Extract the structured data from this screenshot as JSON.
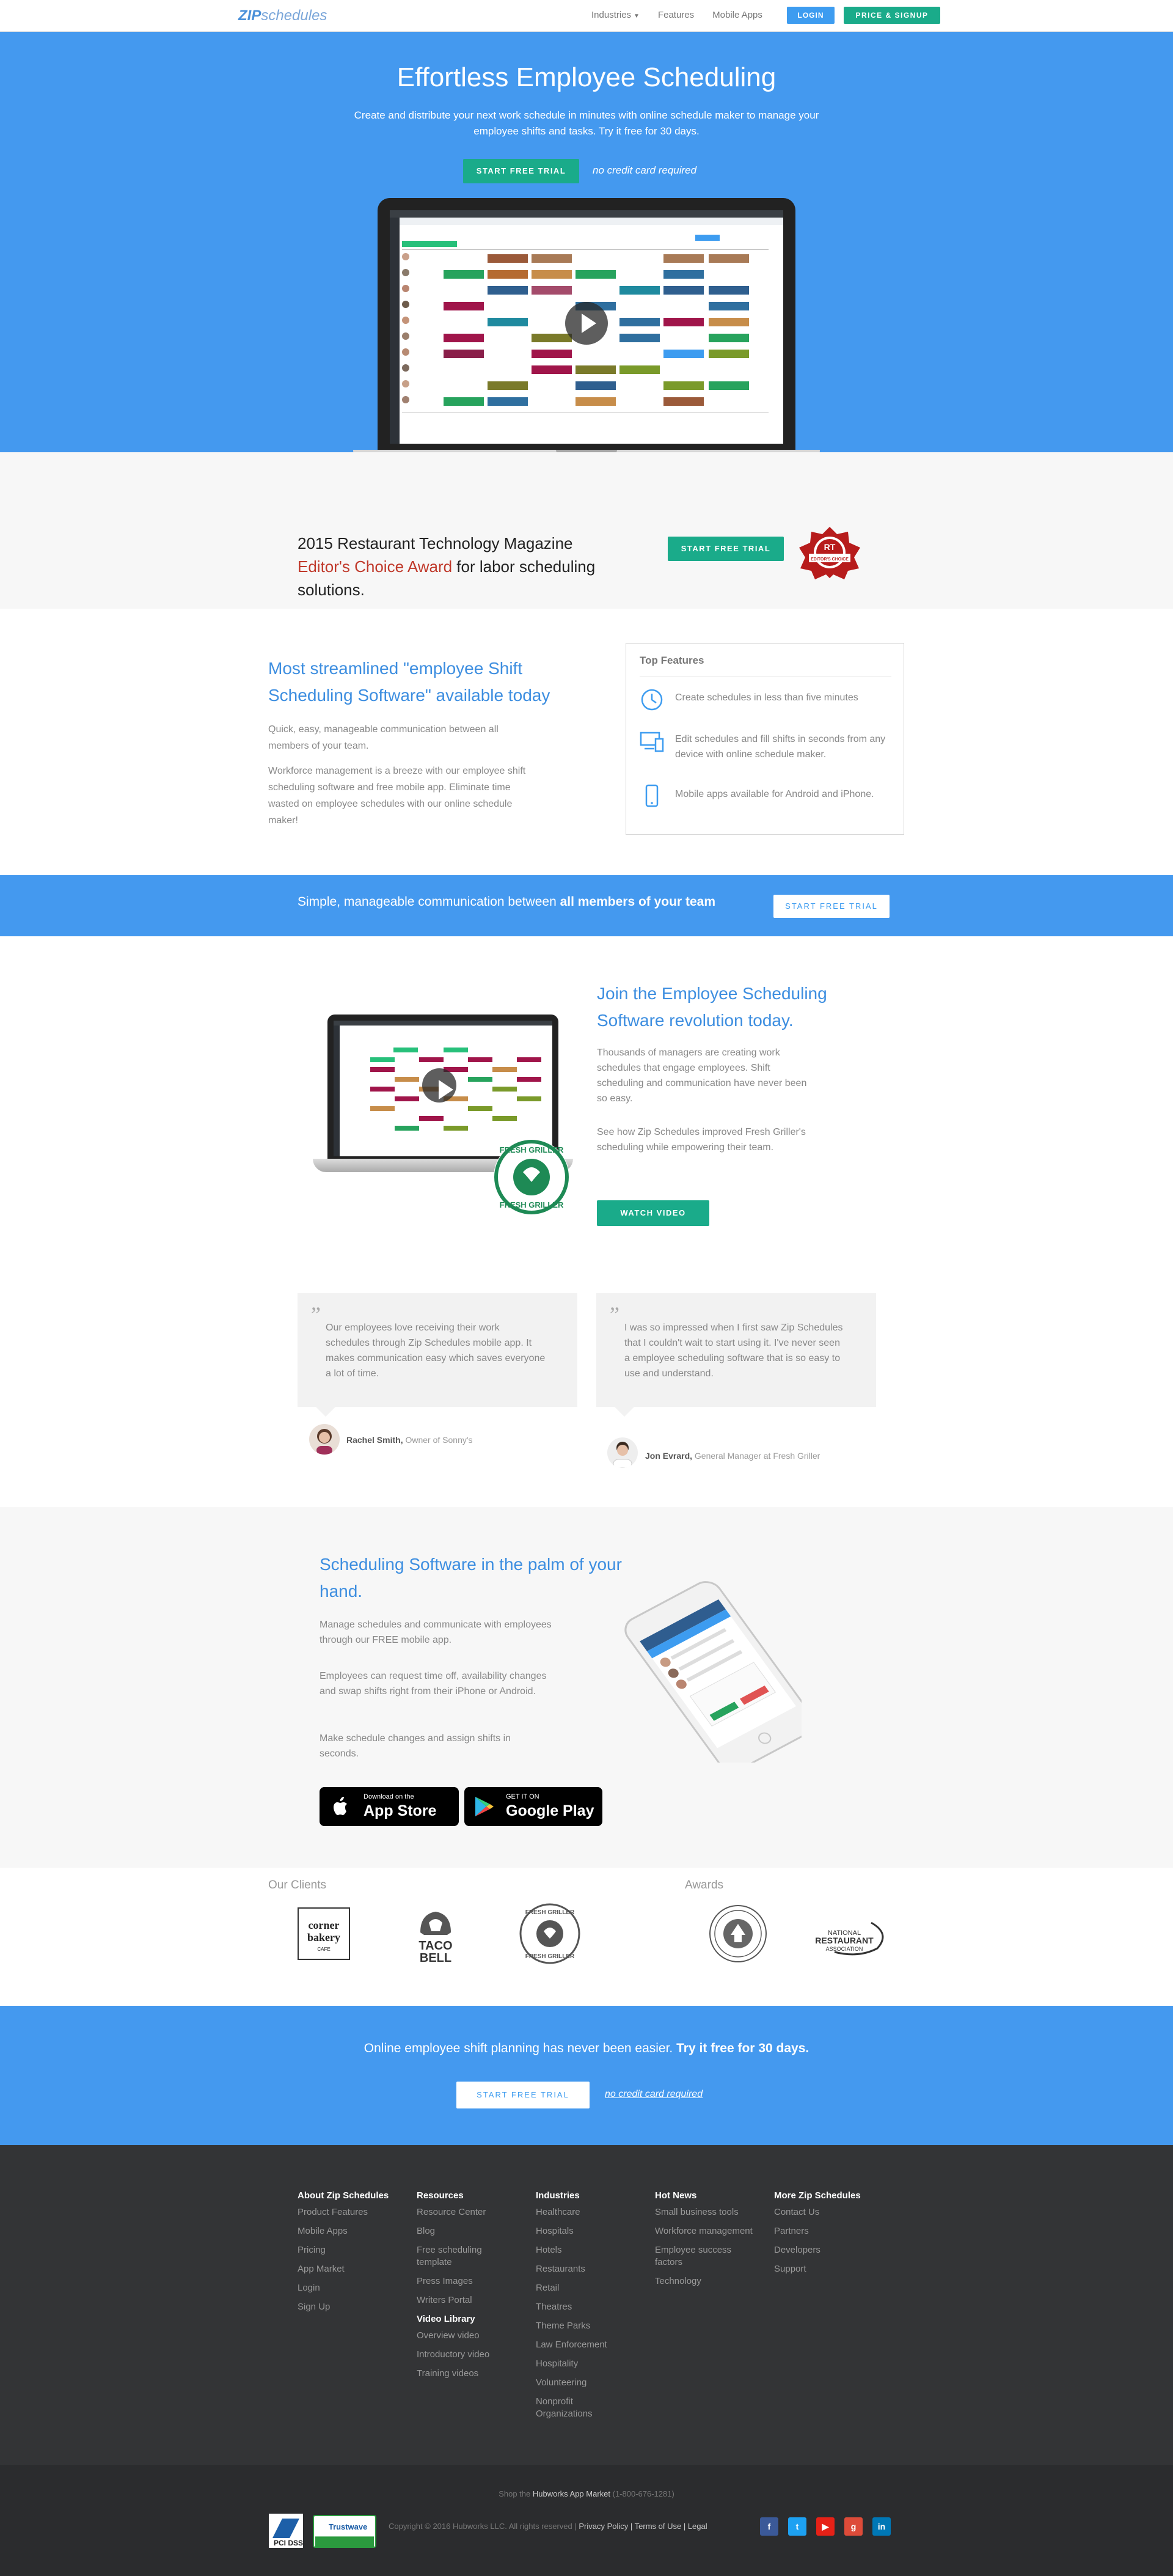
{
  "nav": {
    "logo_bold": "ZIP",
    "logo_rest": "schedules",
    "links": [
      "Industries",
      "Features",
      "Mobile Apps"
    ],
    "login": "LOGIN",
    "signup": "PRICE & SIGNUP"
  },
  "hero": {
    "title": "Effortless Employee Scheduling",
    "subtitle": "Create and distribute your next work schedule in minutes with online schedule maker to manage your employee shifts and tasks. Try it free for 30 days.",
    "cta": "START FREE TRIAL",
    "no_cc": "no credit card required"
  },
  "award": {
    "line1": "2015 Restaurant Technology Magazine",
    "highlight": "Editor's Choice Award",
    "line2": " for labor scheduling solutions.",
    "cta": "START FREE TRIAL",
    "badge_text": "EDITOR'S CHOICE",
    "badge_year": "RT"
  },
  "features": {
    "title": "Most streamlined \"employee Shift Scheduling Software\" available today",
    "p1": "Quick, easy, manageable communication between all members of your team.",
    "p2": "Workforce management is a breeze with our employee shift scheduling software and free mobile app. Eliminate time wasted on employee schedules with our online schedule maker!",
    "box_title": "Top Features",
    "items": [
      {
        "icon": "clock-icon",
        "text": "Create schedules in less than five minutes"
      },
      {
        "icon": "devices-icon",
        "text": "Edit schedules and fill shifts in seconds from any device with online schedule maker."
      },
      {
        "icon": "phone-icon",
        "text": "Mobile apps available for Android and iPhone."
      }
    ]
  },
  "strip": {
    "text": "Simple, manageable communication between ",
    "bold": "all members of your team",
    "cta": "START FREE TRIAL"
  },
  "join": {
    "title": "Join the Employee Scheduling Software revolution today.",
    "p1": "Thousands of managers are creating work schedules that engage employees. Shift scheduling and communication have never been so easy.",
    "p2": "See how Zip Schedules improved Fresh Griller's scheduling while empowering their team.",
    "cta": "WATCH VIDEO",
    "badge": "FRESH GRILLER"
  },
  "testimonials": [
    {
      "quote": "Our employees love receiving their work schedules through Zip Schedules mobile app. It makes communication easy which saves everyone a lot of time.",
      "name": "Rachel Smith,",
      "role": " Owner of Sonny's"
    },
    {
      "quote": "I was so impressed when I first saw Zip Schedules that I couldn't wait to start using it. I've never seen a employee scheduling software that is so easy to use and understand.",
      "name": "Jon Evrard,",
      "role": " General Manager at Fresh Griller"
    }
  ],
  "mobile": {
    "title": "Scheduling Software in the palm of your hand.",
    "p1": "Manage schedules and communicate with employees through our FREE mobile app.",
    "p2": "Employees can request time off, availability changes and swap shifts right from their iPhone or Android.",
    "p3": "Make schedule changes and assign shifts in seconds.",
    "appstore_small": "Download on the",
    "appstore_big": "App Store",
    "gplay_small": "GET IT ON",
    "gplay_big": "Google Play"
  },
  "clients": {
    "heading": "Our Clients",
    "awards_heading": "Awards",
    "corner_bakery": [
      "corner",
      "bakery",
      "CAFE"
    ],
    "taco_bell": [
      "TACO",
      "BELL"
    ],
    "fresh_griller": "FRESH GRILLER",
    "nra": [
      "NATIONAL",
      "RESTAURANT",
      "ASSOCIATION"
    ]
  },
  "cta": {
    "text": "Online employee shift planning has never been easier. ",
    "bold": "Try it free for 30 days.",
    "button": "START FREE TRIAL",
    "no_cc": "no credit card required"
  },
  "footer": {
    "columns": [
      {
        "heading": "About Zip Schedules",
        "items": [
          "Product Features",
          "Mobile Apps",
          "Pricing",
          "App Market",
          "Login",
          "Sign Up"
        ]
      },
      {
        "heading": "Resources",
        "items": [
          "Resource Center",
          "Blog",
          "Free scheduling template",
          "Press Images",
          "Writers Portal"
        ],
        "heading2": "Video Library",
        "items2": [
          "Overview video",
          "Introductory video",
          "Training videos"
        ]
      },
      {
        "heading": "Industries",
        "items": [
          "Healthcare",
          "Hospitals",
          "Hotels",
          "Restaurants",
          "Retail",
          "Theatres",
          "Theme Parks",
          "Law Enforcement",
          "Hospitality",
          "Volunteering",
          "Nonprofit Organizations"
        ]
      },
      {
        "heading": "Hot News",
        "items": [
          "Small business tools",
          "Workforce management",
          "Employee success factors",
          "Technology"
        ]
      },
      {
        "heading": "More Zip Schedules",
        "items": [
          "Contact Us",
          "Partners",
          "Developers",
          "Support"
        ]
      }
    ],
    "shop_prefix": "Shop the ",
    "shop_link": "Hubworks App Market",
    "shop_phone": " (1-800-676-1281)",
    "copyright": "Copyright © 2016 Hubworks LLC. All rights reserved | ",
    "legal_links": "Privacy Policy | Terms of Use | Legal",
    "pci": "PCI DSS",
    "trustwave": "Trustwave"
  },
  "colors": {
    "accent_blue": "#4499ef",
    "accent_green": "#1aab8a",
    "footer_bg": "#333436"
  }
}
